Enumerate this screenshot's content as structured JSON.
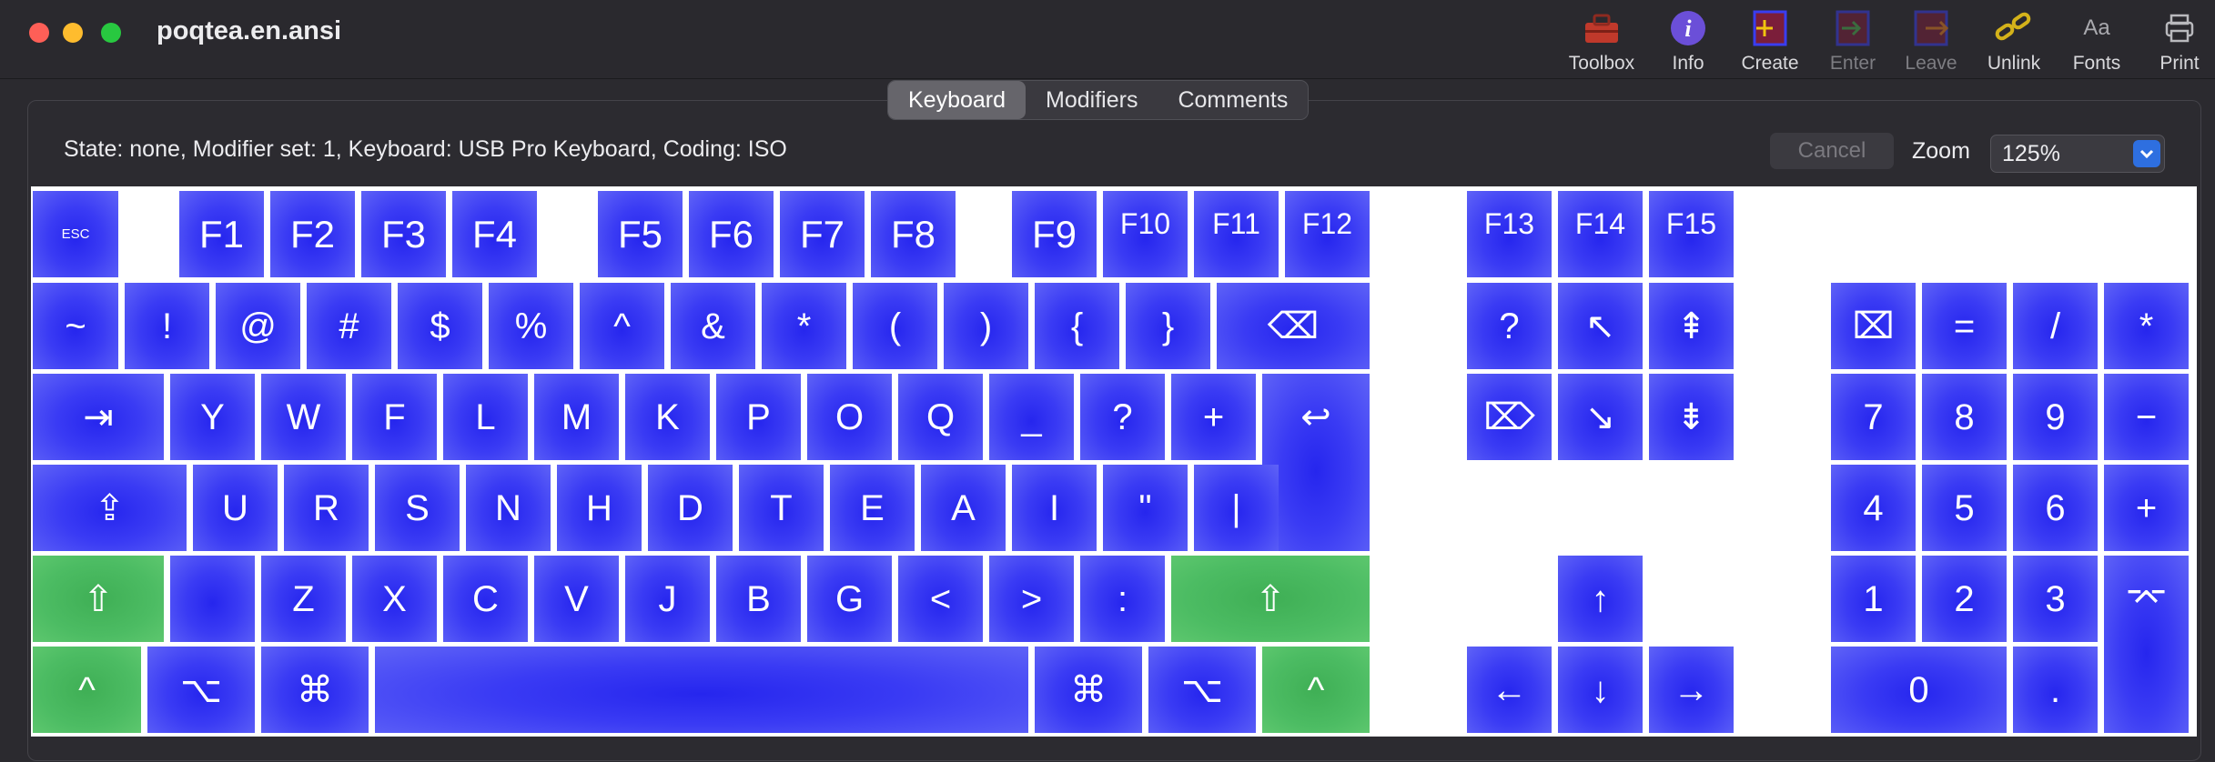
{
  "window": {
    "title": "poqtea.en.ansi"
  },
  "toolbar": {
    "items": [
      {
        "label": "Toolbox",
        "icon": "toolbox-icon",
        "enabled": true
      },
      {
        "label": "Info",
        "icon": "info-icon",
        "enabled": true
      },
      {
        "label": "Create",
        "icon": "create-icon",
        "enabled": true
      },
      {
        "label": "Enter",
        "icon": "enter-icon",
        "enabled": false
      },
      {
        "label": "Leave",
        "icon": "leave-icon",
        "enabled": false
      },
      {
        "label": "Unlink",
        "icon": "unlink-icon",
        "enabled": true
      },
      {
        "label": "Fonts",
        "icon": "fonts-icon",
        "enabled": true,
        "glyph": "Aa"
      },
      {
        "label": "Print",
        "icon": "print-icon",
        "enabled": true
      }
    ]
  },
  "tabs": [
    {
      "label": "Keyboard",
      "active": true
    },
    {
      "label": "Modifiers",
      "active": false
    },
    {
      "label": "Comments",
      "active": false
    }
  ],
  "status_text": "State: none, Modifier set: 1, Keyboard: USB Pro Keyboard, Coding: ISO",
  "cancel_label": "Cancel",
  "zoom": {
    "label": "Zoom",
    "value": "125%"
  },
  "colors": {
    "key_blue": "#3a3bf4",
    "modifier_green": "#4cbc63",
    "accent": "#2e6fe0"
  },
  "keys": {
    "row0": [
      "ESC",
      "F1",
      "F2",
      "F3",
      "F4",
      "F5",
      "F6",
      "F7",
      "F8",
      "F9",
      "F10",
      "F11",
      "F12",
      "F13",
      "F14",
      "F15"
    ],
    "row1": [
      "~",
      "!",
      "@",
      "#",
      "$",
      "%",
      "^",
      "&",
      "*",
      "(",
      ")",
      "{",
      "}",
      "⌫",
      "?",
      "↖",
      "⇞",
      "⌧",
      "=",
      "/",
      "*"
    ],
    "row2": [
      "⇥",
      "Y",
      "W",
      "F",
      "L",
      "M",
      "K",
      "P",
      "O",
      "Q",
      "_",
      "?",
      "+",
      "↩",
      "⌦",
      "↘",
      "⇟",
      "7",
      "8",
      "9",
      "−"
    ],
    "row3": [
      "⇪",
      "U",
      "R",
      "S",
      "N",
      "H",
      "D",
      "T",
      "E",
      "A",
      "I",
      "\"",
      "|",
      "4",
      "5",
      "6",
      "+"
    ],
    "row4": [
      "⇧",
      "",
      "Z",
      "X",
      "C",
      "V",
      "J",
      "B",
      "G",
      "<",
      ">",
      ":",
      "⇧",
      "↑",
      "1",
      "2",
      "3",
      "⌤"
    ],
    "row5": [
      "^",
      "⌥",
      "⌘",
      "",
      "⌘",
      "⌥",
      "^",
      "←",
      "↓",
      "→",
      "0",
      "."
    ]
  }
}
